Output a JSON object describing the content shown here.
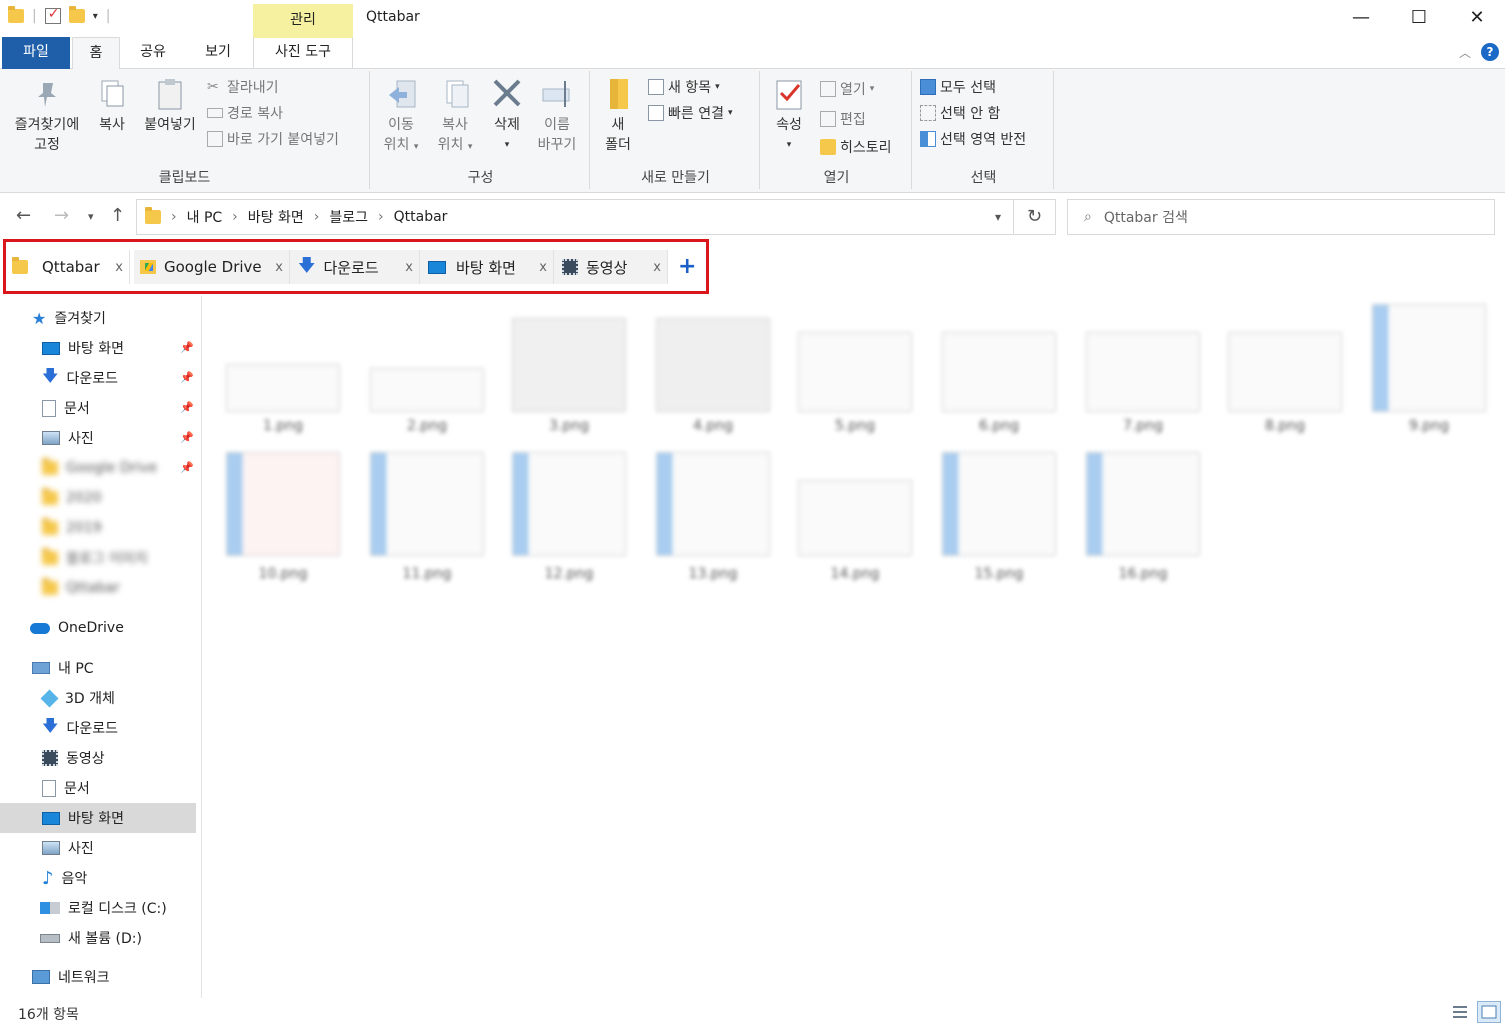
{
  "window": {
    "title": "Qttabar",
    "contextual_group": "관리",
    "minimize": "—",
    "maximize": "☐",
    "close": "✕"
  },
  "ribbon_tabs": {
    "file": "파일",
    "home": "홈",
    "share": "공유",
    "view": "보기",
    "photo_tools": "사진 도구"
  },
  "ribbon": {
    "clipboard": {
      "label": "클립보드",
      "pin_l1": "즐겨찾기에",
      "pin_l2": "고정",
      "copy": "복사",
      "paste": "붙여넣기",
      "cut": "잘라내기",
      "copy_path": "경로 복사",
      "paste_shortcut": "바로 가기 붙여넣기"
    },
    "organize": {
      "label": "구성",
      "move_l1": "이동",
      "move_l2": "위치",
      "copyto_l1": "복사",
      "copyto_l2": "위치",
      "delete": "삭제",
      "rename_l1": "이름",
      "rename_l2": "바꾸기"
    },
    "new": {
      "label": "새로 만들기",
      "folder_l1": "새",
      "folder_l2": "폴더",
      "new_item": "새 항목",
      "easy_access": "빠른 연결"
    },
    "open": {
      "label": "열기",
      "properties": "속성",
      "open": "열기",
      "edit": "편집",
      "history": "히스토리"
    },
    "select": {
      "label": "선택",
      "select_all": "모두 선택",
      "select_none": "선택 안 함",
      "invert": "선택 영역 반전"
    }
  },
  "address": {
    "crumbs": [
      "내 PC",
      "바탕 화면",
      "블로그",
      "Qttabar"
    ],
    "search_placeholder": "Qttabar 검색"
  },
  "qttabs": [
    {
      "label": "Qttabar",
      "close": "x"
    },
    {
      "label": "Google Drive",
      "close": "x"
    },
    {
      "label": "다운로드",
      "close": "x"
    },
    {
      "label": "바탕 화면",
      "close": "x"
    },
    {
      "label": "동영상",
      "close": "x"
    }
  ],
  "qttab_add": "+",
  "navpane": {
    "quick_access": "즐겨찾기",
    "quick_items": [
      "바탕 화면",
      "다운로드",
      "문서",
      "사진",
      "Google Drive",
      "2020",
      "2019",
      "블로그 이미지",
      "Qttabar"
    ],
    "onedrive": "OneDrive",
    "this_pc": "내 PC",
    "pc_items": [
      "3D 개체",
      "다운로드",
      "동영상",
      "문서",
      "바탕 화면",
      "사진",
      "음악",
      "로컬 디스크 (C:)",
      "새 볼륨 (D:)"
    ],
    "network": "네트워크"
  },
  "files": [
    "1.png",
    "2.png",
    "3.png",
    "4.png",
    "5.png",
    "6.png",
    "7.png",
    "8.png",
    "9.png",
    "10.png",
    "11.png",
    "12.png",
    "13.png",
    "14.png",
    "15.png",
    "16.png"
  ],
  "status": {
    "count": "16개 항목"
  },
  "colors": {
    "accent": "#1f5faa",
    "highlight_box": "#d9161c",
    "contextual": "#f6f1a0",
    "folder": "#f5c84c"
  }
}
